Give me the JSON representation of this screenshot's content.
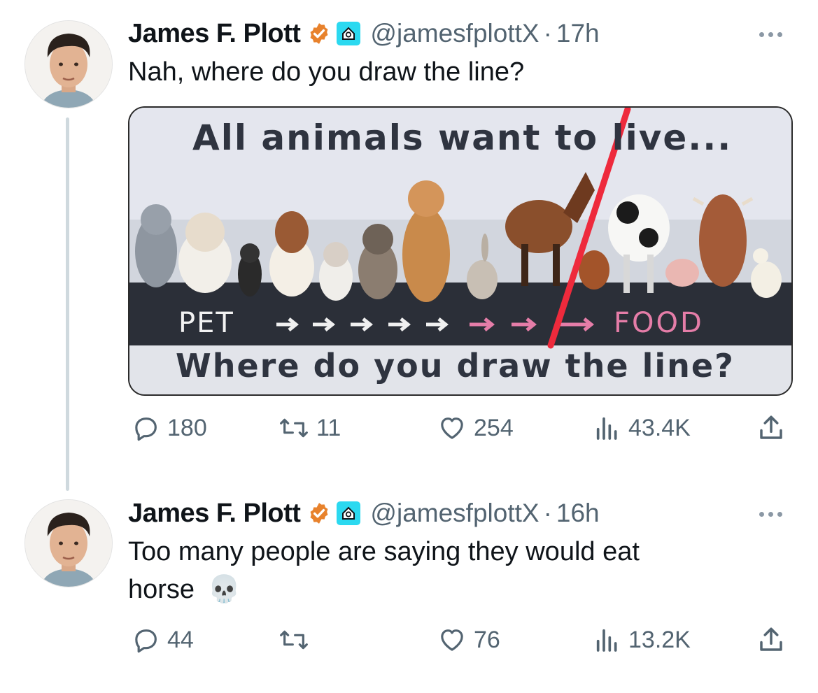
{
  "thread": [
    {
      "author": {
        "name": "James F. Plott",
        "handle": "@jamesfplottX",
        "time": "17h",
        "separator": "·"
      },
      "text": "Nah, where do you draw the line?",
      "media": {
        "headline": "All animals want to live...",
        "pet_label": "PET",
        "food_label": "FOOD",
        "question": "Where do you draw the line?",
        "animals": [
          "cat",
          "bulldog",
          "kitten",
          "basset hound",
          "cat",
          "french bulldog",
          "golden retriever",
          "rabbit",
          "horse",
          "chicken",
          "cow",
          "pig",
          "highland cow",
          "duck"
        ]
      },
      "stats": {
        "replies": "180",
        "reposts": "11",
        "likes": "254",
        "views": "43.4K"
      }
    },
    {
      "author": {
        "name": "James F. Plott",
        "handle": "@jamesfplottX",
        "time": "16h",
        "separator": "·"
      },
      "text_line1": "Too many people are saying they would eat",
      "text_line2": "horse",
      "emoji": "💀",
      "stats": {
        "replies": "44",
        "reposts": "",
        "likes": "76",
        "views": "13.2K"
      }
    }
  ],
  "icons": {
    "verified": "verified-badge-icon",
    "affiliate": "affiliate-badge-icon",
    "more": "more-dots-icon",
    "reply": "reply-icon",
    "repost": "repost-icon",
    "like": "heart-icon",
    "views": "views-chart-icon",
    "share": "share-icon"
  },
  "colors": {
    "verified": "#e8822c",
    "affiliate": "#2bd9f0",
    "muted": "#536471",
    "line": "#cfd9de",
    "redline": "#ee2a3c",
    "pink_arrow": "#e57da8"
  }
}
